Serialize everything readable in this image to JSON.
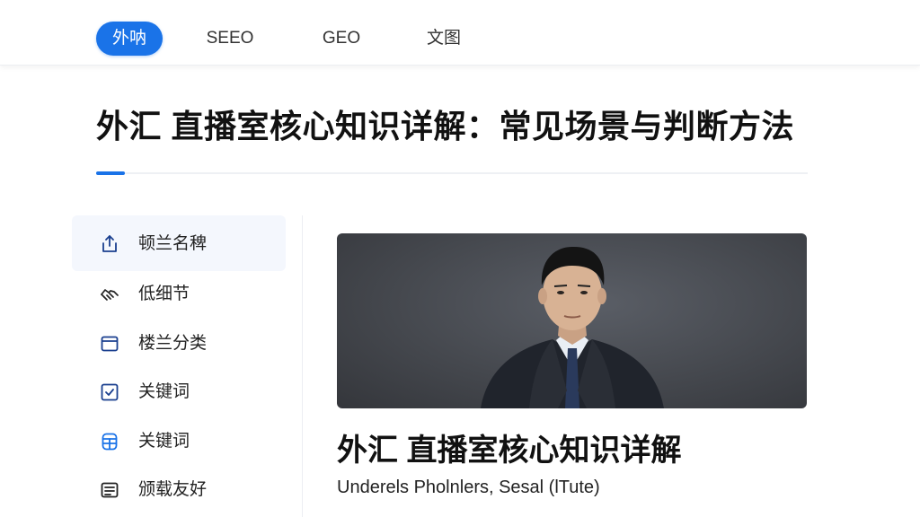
{
  "nav": {
    "tabs": [
      {
        "label": "外呐",
        "active": true
      },
      {
        "label": "SEEO",
        "active": false
      },
      {
        "label": "GEO",
        "active": false
      },
      {
        "label": "文图",
        "active": false
      }
    ]
  },
  "page": {
    "title": "外汇 直播室核心知识详解：常见场景与判断方法"
  },
  "sidebar": {
    "items": [
      {
        "label": "顿兰名稗",
        "icon": "share-upload-icon",
        "active": true
      },
      {
        "label": "低细节",
        "icon": "handshake-icon",
        "active": false
      },
      {
        "label": "楼兰分类",
        "icon": "folder-icon",
        "active": false
      },
      {
        "label": "关键词",
        "icon": "checkbox-icon",
        "active": false
      },
      {
        "label": "关键词",
        "icon": "database-icon",
        "active": false
      },
      {
        "label": "颁载友好",
        "icon": "document-icon",
        "active": false
      }
    ]
  },
  "article": {
    "title": "外汇  直播室核心知识详解",
    "subtitle": "Underels Pholnlers,  Sesal (lTute)"
  },
  "colors": {
    "accent": "#1a73e8",
    "icon": "#1a3f8f"
  }
}
